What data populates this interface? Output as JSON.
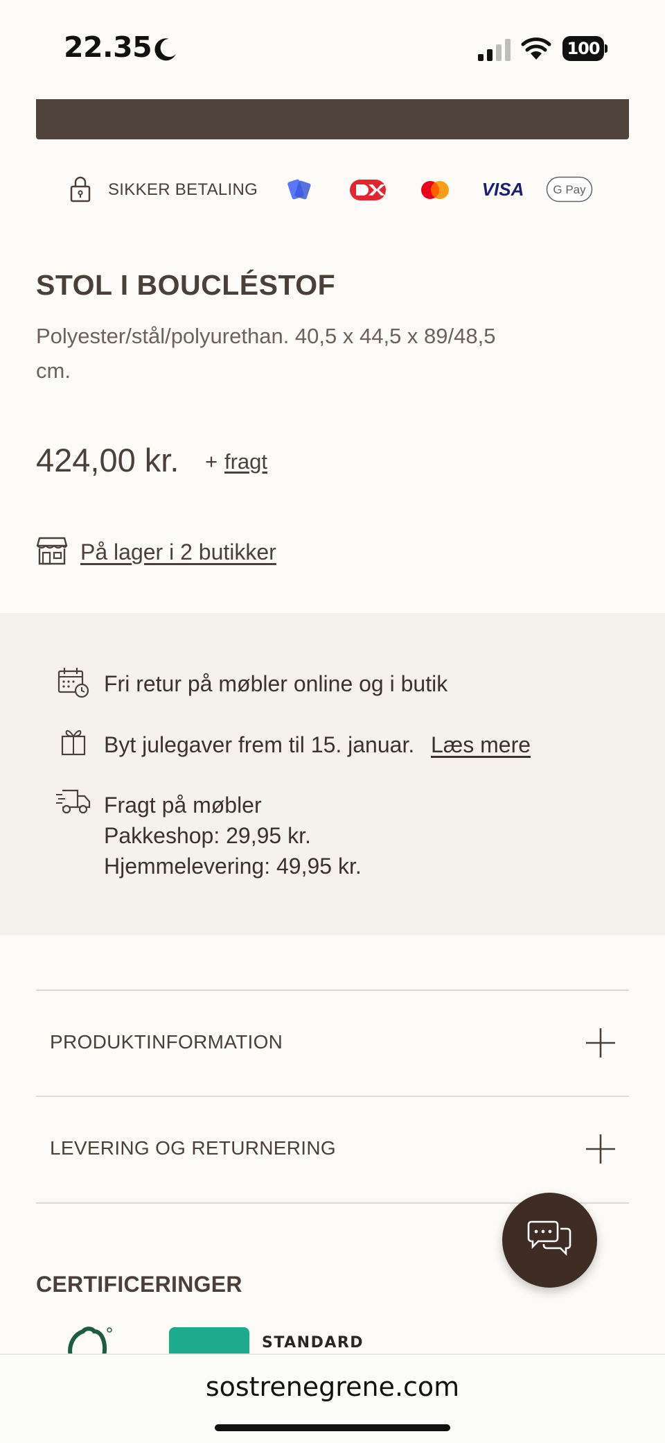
{
  "status_bar": {
    "time": "22.35",
    "battery": "100",
    "icons": [
      "moon-icon",
      "cellular-signal-icon",
      "wifi-icon",
      "battery-icon"
    ]
  },
  "payment": {
    "secure_label": "SIKKER BETALING",
    "methods": [
      "MobilePay",
      "Dankort",
      "Mastercard",
      "VISA",
      "G Pay"
    ],
    "visa_text": "VISA",
    "gpay_text": "G Pay"
  },
  "product": {
    "title": "STOL I BOUCLÉSTOF",
    "description_line1": "Polyester/stål/polyurethan. 40,5 x 44,5 x 89/48,5",
    "description_line2": "cm.",
    "price": "424,00 kr.",
    "freight_prefix": "+",
    "freight_link": "fragt",
    "stock_link": "På lager i 2 butikker"
  },
  "info": {
    "return_text": "Fri retur på møbler online og i butik",
    "exchange_text": "Byt julegaver frem til 15. januar.",
    "read_more": "Læs mere",
    "freight_title": "Fragt på møbler",
    "freight_pakkeshop": "Pakkeshop: 29,95 kr.",
    "freight_home": "Hjemmelevering: 49,95 kr."
  },
  "accordions": {
    "product_info": "PRODUKTINFORMATION",
    "delivery": "LEVERING OG RETURNERING"
  },
  "certifications": {
    "heading": "CERTIFICERINGER",
    "oeko_standard": "STANDARD"
  },
  "browser": {
    "url": "sostrenegrene.com"
  },
  "colors": {
    "background": "#fcfbf7",
    "text": "#4a3f39",
    "brand_brown": "#50433b",
    "chat_button": "#3f2c25",
    "info_panel": "#f5f2ed",
    "oeko_green": "#1eaa8c"
  }
}
